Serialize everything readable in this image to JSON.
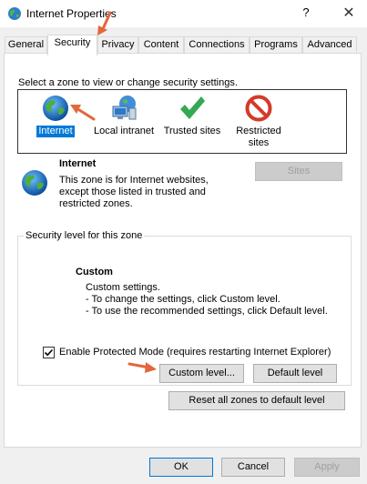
{
  "window": {
    "title": "Internet Properties",
    "help_glyph": "?",
    "close_glyph": "✕"
  },
  "tabs": [
    "General",
    "Security",
    "Privacy",
    "Content",
    "Connections",
    "Programs",
    "Advanced"
  ],
  "active_tab": "Security",
  "security": {
    "prompt": "Select a zone to view or change security settings.",
    "zones": [
      {
        "label": "Internet",
        "icon": "globe-icon",
        "selected": true
      },
      {
        "label": "Local intranet",
        "icon": "network-computer-icon",
        "selected": false
      },
      {
        "label": "Trusted sites",
        "icon": "green-check-icon",
        "selected": false
      },
      {
        "label": "Restricted\nsites",
        "icon": "red-no-icon",
        "selected": false
      }
    ],
    "zone_info": {
      "title": "Internet",
      "description": "This zone is for Internet websites, except those listed in trusted and restricted zones.",
      "sites_button": "Sites"
    },
    "level_group": {
      "legend": "Security level for this zone",
      "level_title": "Custom",
      "level_lines": [
        "Custom settings.",
        "- To change the settings, click Custom level.",
        "- To use the recommended settings, click Default level."
      ],
      "protected_mode_label": "Enable Protected Mode (requires restarting Internet Explorer)",
      "protected_mode_checked": true,
      "custom_level_button": "Custom level...",
      "default_level_button": "Default level"
    },
    "reset_all_button": "Reset all zones to default level"
  },
  "footer": {
    "ok": "OK",
    "cancel": "Cancel",
    "apply": "Apply"
  },
  "colors": {
    "selection": "#0078d7",
    "annotation_arrow": "#e2673c"
  }
}
